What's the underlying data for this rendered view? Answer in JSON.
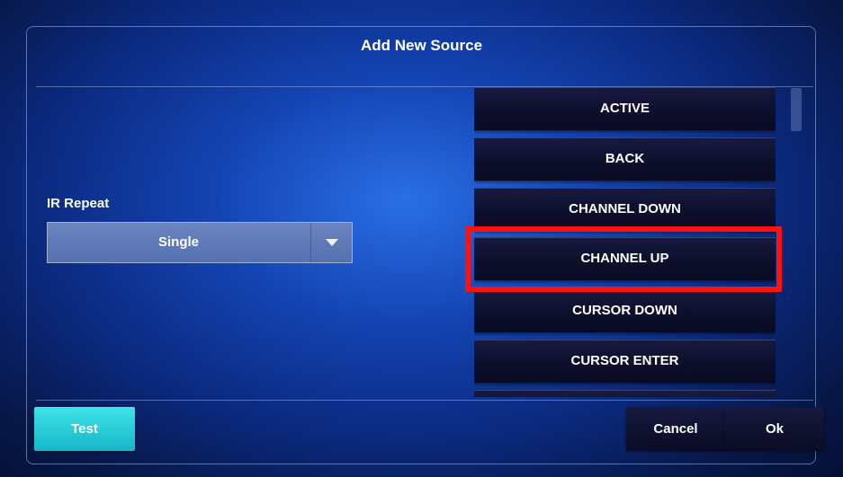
{
  "dialog": {
    "title": "Add New Source"
  },
  "ir_repeat": {
    "label": "IR Repeat",
    "selected": "Single"
  },
  "command_list": {
    "items": [
      {
        "label": "ACTIVE"
      },
      {
        "label": "BACK"
      },
      {
        "label": "CHANNEL DOWN"
      },
      {
        "label": "CHANNEL UP",
        "highlighted": true
      },
      {
        "label": "CURSOR DOWN"
      },
      {
        "label": "CURSOR ENTER"
      },
      {
        "label": ""
      }
    ]
  },
  "footer": {
    "test_label": "Test",
    "cancel_label": "Cancel",
    "ok_label": "Ok"
  },
  "colors": {
    "highlight": "#ff1111",
    "test_button": "#22c8d4",
    "button_dark": "#0d0f2c"
  }
}
